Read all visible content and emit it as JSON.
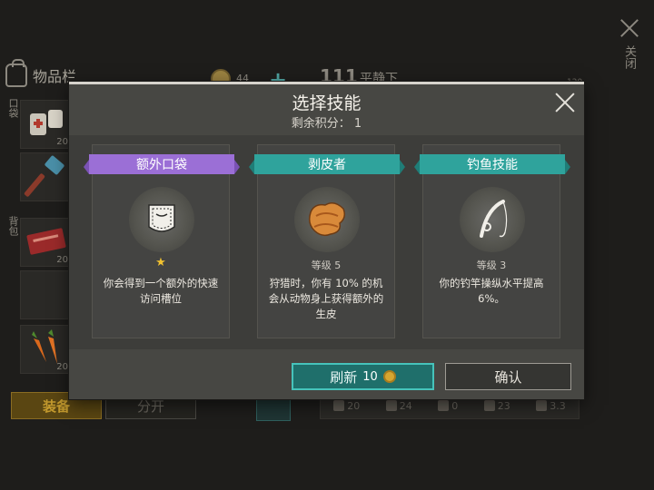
{
  "background": {
    "inventory_title": "物品栏",
    "coin_count": "44",
    "level_number": "111",
    "status_text": "平静下",
    "corner_number": "120",
    "pocket_label": "口袋",
    "backpack_label": "背包",
    "slot_counts": [
      "20",
      "20",
      "20",
      "20"
    ],
    "equip_label": "装备",
    "split_label": "分开",
    "close_label": "关闭",
    "stats": [
      "20",
      "24",
      "0",
      "23",
      "3.3"
    ]
  },
  "modal": {
    "title": "选择技能",
    "remaining_points": "剩余积分： 1",
    "cards": [
      {
        "name": "额外口袋",
        "ribbon_color": "#9b6fd6",
        "icon": "pocket-icon",
        "rating": "★",
        "level": "",
        "description": "你会得到一个额外的快速访问槽位"
      },
      {
        "name": "剥皮者",
        "ribbon_color": "#2fa39c",
        "icon": "leather-hide-icon",
        "rating": "",
        "level": "等级 5",
        "description": "狩猎时，你有 10% 的机会从动物身上获得额外的生皮"
      },
      {
        "name": "钓鱼技能",
        "ribbon_color": "#2fa39c",
        "icon": "fishing-rod-icon",
        "rating": "",
        "level": "等级 3",
        "description": "你的钓竿操纵水平提高 6%。"
      }
    ],
    "refresh_label": "刷新",
    "refresh_cost": "10",
    "confirm_label": "确认"
  }
}
